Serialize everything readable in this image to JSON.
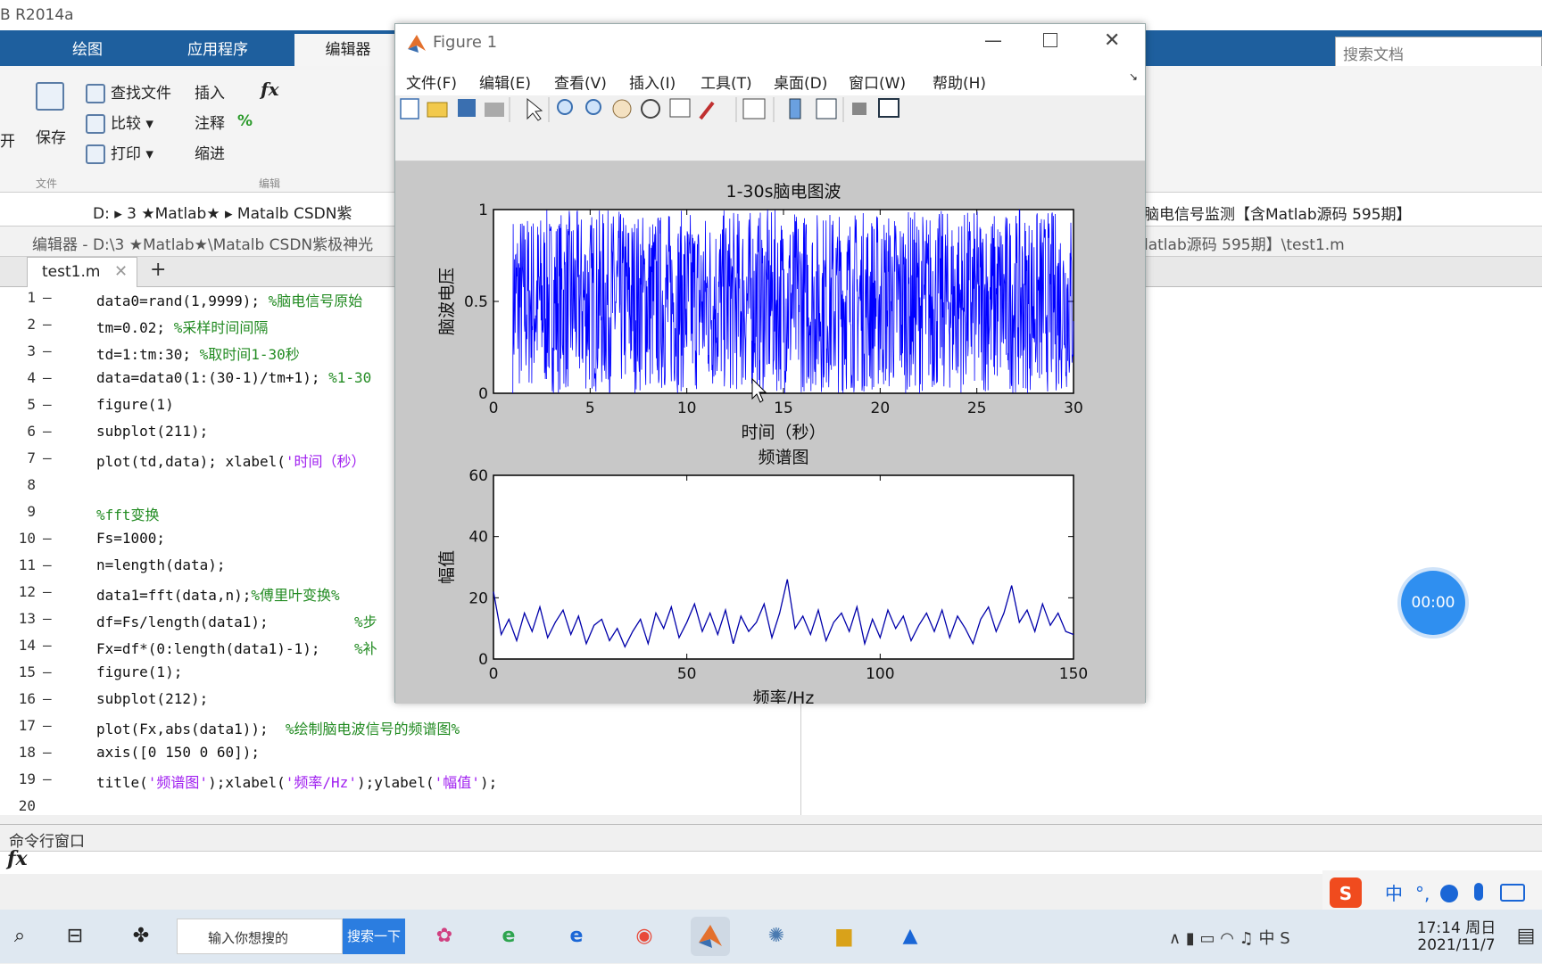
{
  "app": {
    "title": "B R2014a"
  },
  "ribbon_tabs": [
    "绘图",
    "应用程序",
    "编辑器"
  ],
  "ribbon": {
    "open_label": "开",
    "save_label": "保存",
    "find_files": "查找文件",
    "compare": "比较",
    "print": "打印",
    "insert": "插入",
    "comment": "注释",
    "indent": "缩进",
    "group_file": "文件",
    "group_edit": "编辑"
  },
  "search_docs": {
    "placeholder": "搜索文档"
  },
  "address": {
    "path_parts": [
      "D:",
      "3 ★Matlab★",
      "Matalb CSDN紫"
    ],
    "right_part": "脑电信号监测【含Matlab源码 595期】"
  },
  "editor_header": {
    "left": "编辑器 - D:\\3 ★Matlab★\\Matalb CSDN紫极神光",
    "right": "latlab源码 595期】\\test1.m"
  },
  "file_tab": {
    "name": "test1.m"
  },
  "code_lines": [
    {
      "n": "1",
      "dash": "–",
      "code": "data0=rand(1,9999);",
      "comment": " %脑电信号原始"
    },
    {
      "n": "2",
      "dash": "–",
      "code": "tm=0.02;",
      "comment": " %采样时间间隔"
    },
    {
      "n": "3",
      "dash": "–",
      "code": "td=1:tm:30;",
      "comment": " %取时间1-30秒"
    },
    {
      "n": "4",
      "dash": "–",
      "code": "data=data0(1:(30-1)/tm+1);",
      "comment": " %1-30"
    },
    {
      "n": "5",
      "dash": "–",
      "code": "figure(1)",
      "comment": ""
    },
    {
      "n": "6",
      "dash": "–",
      "code": "subplot(211);",
      "comment": ""
    },
    {
      "n": "7",
      "dash": "–",
      "code": "plot(td,data); xlabel(",
      "str": "'时间（秒）",
      "comment": ""
    },
    {
      "n": "8",
      "dash": "",
      "code": "",
      "comment": ""
    },
    {
      "n": "9",
      "dash": "",
      "code": "",
      "comment": "%fft变换"
    },
    {
      "n": "10",
      "dash": "–",
      "code": "Fs=1000;",
      "comment": ""
    },
    {
      "n": "11",
      "dash": "–",
      "code": "n=length(data);",
      "comment": ""
    },
    {
      "n": "12",
      "dash": "–",
      "code": "data1=fft(data,n);",
      "comment": "%傅里叶变换%"
    },
    {
      "n": "13",
      "dash": "–",
      "code": "df=Fs/length(data1);",
      "comment": "          %步"
    },
    {
      "n": "14",
      "dash": "–",
      "code": "Fx=df*(0:length(data1)-1);",
      "comment": "    %补"
    },
    {
      "n": "15",
      "dash": "–",
      "code": "figure(1);",
      "comment": ""
    },
    {
      "n": "16",
      "dash": "–",
      "code": "subplot(212);",
      "comment": ""
    },
    {
      "n": "17",
      "dash": "–",
      "code": "plot(Fx,abs(data1));",
      "comment": "  %绘制脑电波信号的频谱图%"
    },
    {
      "n": "18",
      "dash": "–",
      "code": "axis([0 150 0 60]);",
      "comment": ""
    },
    {
      "n": "19",
      "dash": "–",
      "code": "title(",
      "str": "'频谱图'",
      "code2": ");xlabel(",
      "str2": "'频率/Hz'",
      "code3": ");ylabel(",
      "str3": "'幅值'",
      "code4": ");",
      "comment": ""
    },
    {
      "n": "20",
      "dash": "",
      "code": "",
      "comment": ""
    }
  ],
  "command_window": {
    "label": "命令行窗口",
    "fx": "fx"
  },
  "timer": {
    "text": "00:00"
  },
  "figure": {
    "title": "Figure 1",
    "menus": [
      "文件(F)",
      "编辑(E)",
      "查看(V)",
      "插入(I)",
      "工具(T)",
      "桌面(D)",
      "窗口(W)",
      "帮助(H)"
    ]
  },
  "chart_data": [
    {
      "type": "line",
      "title": "1-30s脑电图波",
      "xlabel": "时间（秒）",
      "ylabel": "脑波电压",
      "xlim": [
        0,
        30
      ],
      "ylim": [
        0,
        1
      ],
      "xticks": [
        "0",
        "5",
        "10",
        "15",
        "20",
        "25",
        "30"
      ],
      "yticks": [
        "0",
        "0.5",
        "1"
      ],
      "series_color": "#0000ff",
      "x_range": [
        1,
        30
      ],
      "sample_interval": 0.02,
      "value_range": [
        0,
        1
      ]
    },
    {
      "type": "line",
      "title": "频谱图",
      "xlabel": "频率/Hz",
      "ylabel": "幅值",
      "xlim": [
        0,
        150
      ],
      "ylim": [
        0,
        60
      ],
      "xticks": [
        "0",
        "50",
        "100",
        "150"
      ],
      "yticks": [
        "0",
        "20",
        "40",
        "60"
      ],
      "series_color": "#0000aa",
      "x": [
        0,
        2,
        4,
        6,
        8,
        10,
        12,
        14,
        16,
        18,
        20,
        22,
        24,
        26,
        28,
        30,
        32,
        34,
        36,
        38,
        40,
        42,
        44,
        46,
        48,
        50,
        52,
        54,
        56,
        58,
        60,
        62,
        64,
        66,
        68,
        70,
        72,
        74,
        76,
        78,
        80,
        82,
        84,
        86,
        88,
        90,
        92,
        94,
        96,
        98,
        100,
        102,
        104,
        106,
        108,
        110,
        112,
        114,
        116,
        118,
        120,
        122,
        124,
        126,
        128,
        130,
        132,
        134,
        136,
        138,
        140,
        142,
        144,
        146,
        148,
        150
      ],
      "values": [
        22,
        8,
        13,
        6,
        15,
        9,
        17,
        7,
        12,
        16,
        8,
        14,
        5,
        11,
        13,
        6,
        10,
        4,
        9,
        13,
        5,
        15,
        10,
        17,
        7,
        12,
        18,
        9,
        15,
        8,
        16,
        5,
        14,
        9,
        12,
        18,
        7,
        15,
        26,
        10,
        14,
        8,
        16,
        6,
        12,
        15,
        9,
        17,
        5,
        13,
        7,
        16,
        10,
        14,
        6,
        11,
        15,
        9,
        16,
        7,
        14,
        10,
        5,
        13,
        17,
        9,
        15,
        24,
        12,
        16,
        9,
        18,
        11,
        15,
        9,
        8
      ]
    }
  ],
  "taskbar": {
    "search_placeholder": "输入你想搜的",
    "search_button": "搜索一下",
    "clock_time": "17:14 周日",
    "clock_date": "2021/11/7"
  }
}
